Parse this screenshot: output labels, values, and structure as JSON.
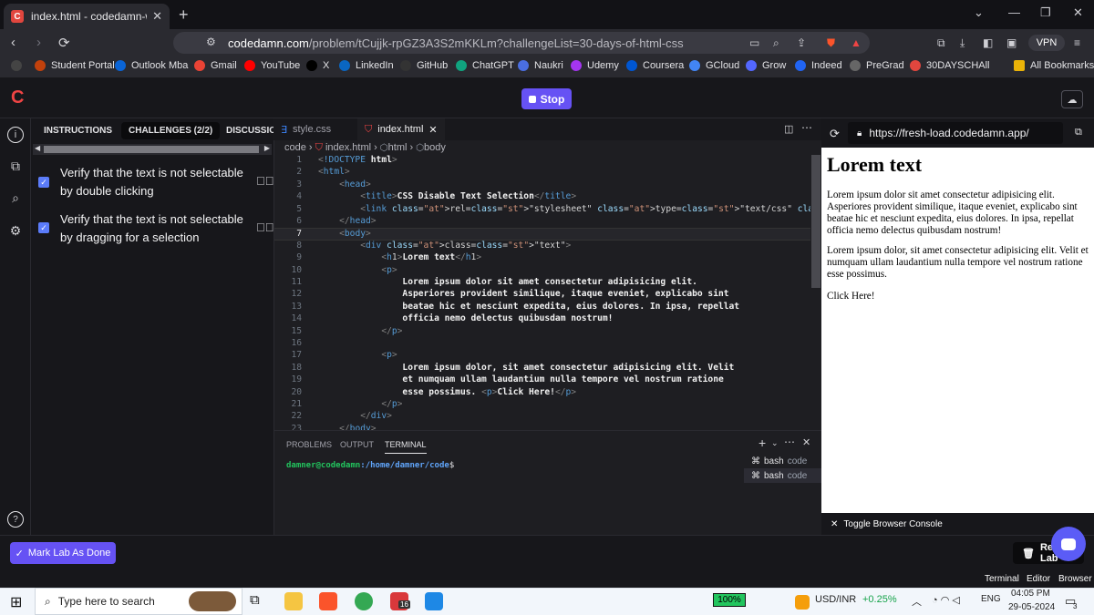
{
  "browser": {
    "tab_title": "index.html - codedamn-workspac",
    "url_host": "codedamn.com",
    "url_path": "/problem/tCujjk-rpGZ3A3S2mKKLm?challengeList=30-days-of-html-css",
    "vpn_label": "VPN",
    "bookmarks": [
      {
        "label": "Student Portal",
        "color": "#c2410c"
      },
      {
        "label": "Outlook Mba",
        "color": "#0a64d6"
      },
      {
        "label": "Gmail",
        "color": "#ea4335"
      },
      {
        "label": "YouTube",
        "color": "#ff0000"
      },
      {
        "label": "X",
        "color": "#000000"
      },
      {
        "label": "LinkedIn",
        "color": "#0a66c2"
      },
      {
        "label": "GitHub",
        "color": "#333333"
      },
      {
        "label": "ChatGPT",
        "color": "#10a37f"
      },
      {
        "label": "Naukri",
        "color": "#4a6ee0"
      },
      {
        "label": "Udemy",
        "color": "#a435f0"
      },
      {
        "label": "Coursera",
        "color": "#0056d2"
      },
      {
        "label": "GCloud",
        "color": "#4285f4"
      },
      {
        "label": "Grow",
        "color": "#5367ff"
      },
      {
        "label": "Indeed",
        "color": "#2164f3"
      },
      {
        "label": "PreGrad",
        "color": "#666666"
      },
      {
        "label": "30DAYSCHAll",
        "color": "#e1463e"
      }
    ],
    "all_bookmarks": "All Bookmarks"
  },
  "app": {
    "stop_label": "Stop",
    "instruction_tabs": [
      "INSTRUCTIONS",
      "CHALLENGES (2/2)",
      "DISCUSSION"
    ],
    "challenges": [
      "Verify that the text is not selectable by double clicking",
      "Verify that the text is not selectable by dragging for a selection"
    ],
    "mark_done": "Mark Lab As Done",
    "reset_lab": "Reset Lab",
    "modes": [
      "Terminal",
      "Editor",
      "Browser"
    ]
  },
  "editor": {
    "tabs": [
      "style.css",
      "index.html"
    ],
    "breadcrumb": [
      "code",
      "index.html",
      "html",
      "body"
    ],
    "current_line": 7,
    "lines": [
      "<!DOCTYPE html>",
      "<html>",
      "    <head>",
      "        <title>CSS Disable Text Selection</title>",
      "        <link rel=\"stylesheet\" type=\"text/css\" href=\"style.css\" />",
      "    </head>",
      "    <body>",
      "        <div class=\"text\">",
      "            <h1>Lorem text</h1>",
      "            <p>",
      "                Lorem ipsum dolor sit amet consectetur adipisicing elit.",
      "                Asperiores provident similique, itaque eveniet, explicabo sint",
      "                beatae hic et nesciunt expedita, eius dolores. In ipsa, repellat",
      "                officia nemo delectus quibusdam nostrum!",
      "            </p>",
      "",
      "            <p>",
      "                Lorem ipsum dolor, sit amet consectetur adipisicing elit. Velit",
      "                et numquam ullam laudantium nulla tempore vel nostrum ratione",
      "                esse possimus. <p>Click Here!</p>",
      "            </p>",
      "        </div>",
      "    </body>"
    ]
  },
  "terminal": {
    "tabs": [
      "PROBLEMS",
      "OUTPUT",
      "TERMINAL"
    ],
    "prompt_user": "damner@codedamn",
    "prompt_path": ":/home/damner/code",
    "prompt_end": "$",
    "sessions": [
      {
        "name": "bash",
        "sub": "code"
      },
      {
        "name": "bash",
        "sub": "code"
      }
    ]
  },
  "preview": {
    "url": "https://fresh-load.codedamn.app/",
    "heading": "Lorem text",
    "para1": "Lorem ipsum dolor sit amet consectetur adipisicing elit. Asperiores provident similique, itaque eveniet, explicabo sint beatae hic et nesciunt expedita, eius dolores. In ipsa, repellat officia nemo delectus quibusdam nostrum!",
    "para2": "Lorem ipsum dolor, sit amet consectetur adipisicing elit. Velit et numquam ullam laudantium nulla tempore vel nostrum ratione esse possimus.",
    "para3": "Click Here!",
    "console_toggle": "Toggle Browser Console"
  },
  "taskbar": {
    "search_placeholder": "Type here to search",
    "battery": "100%",
    "currency": "USD/INR",
    "currency_change": "+0.25%",
    "lang": "ENG",
    "time": "04:05 PM",
    "date": "29-05-2024",
    "notif_count": "3",
    "badge_count": "16"
  }
}
